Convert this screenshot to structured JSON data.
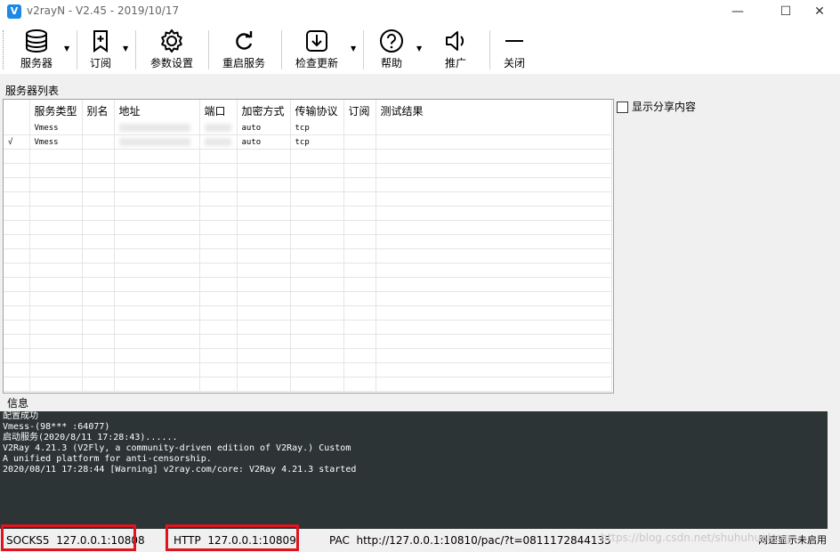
{
  "window": {
    "title": "v2rayN - V2.45 - 2019/10/17",
    "app_icon_glyph": "V",
    "controls": {
      "minimize": "—",
      "maximize": "☐",
      "close": "✕"
    }
  },
  "toolbar": {
    "servers": "服务器",
    "subscribe": "订阅",
    "settings": "参数设置",
    "restart": "重启服务",
    "check_update": "检查更新",
    "help": "帮助",
    "promote": "推广",
    "close": "关闭",
    "dropdown_glyph": "▼"
  },
  "server_list": {
    "label": "服务器列表",
    "columns": [
      "服务类型",
      "别名",
      "地址",
      "端口",
      "加密方式",
      "传输协议",
      "订阅",
      "测试结果"
    ],
    "rows": [
      {
        "active": "",
        "type": "Vmess",
        "alias": "",
        "address": "",
        "port": "",
        "security": "auto",
        "network": "tcp",
        "sub": "",
        "test": ""
      },
      {
        "active": "√",
        "type": "Vmess",
        "alias": "",
        "address": "",
        "port": "",
        "security": "auto",
        "network": "tcp",
        "sub": "",
        "test": ""
      }
    ]
  },
  "share_checkbox": {
    "label": "显示分享内容",
    "checked": false
  },
  "info": {
    "label": "信息",
    "lines": [
      "配置成功",
      "Vmess-(98***  :64077)",
      "启动服务(2020/8/11 17:28:43)......",
      "V2Ray 4.21.3 (V2Fly, a community-driven edition of V2Ray.) Custom",
      "A unified platform for anti-censorship.",
      "2020/08/11 17:28:44 [Warning] v2ray.com/core: V2Ray 4.21.3 started"
    ]
  },
  "status": {
    "socks_label": "SOCKS5",
    "socks_value": "127.0.0.1:10808",
    "http_label": "HTTP",
    "http_value": "127.0.0.1:10809",
    "pac_label": "PAC",
    "pac_value": "http://127.0.0.1:10810/pac/?t=0811172844135",
    "speed": "网速显示未启用",
    "highlight_color": "#e0141e"
  },
  "watermark": "https://blog.csdn.net/shuhuhualang"
}
